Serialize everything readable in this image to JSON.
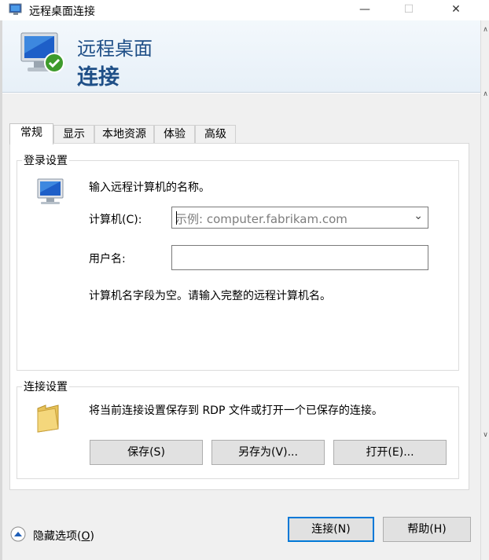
{
  "window": {
    "title": "远程桌面连接",
    "minimize": "—",
    "maximize": "☐",
    "close": "✕"
  },
  "header": {
    "line1": "远程桌面",
    "line2": "连接"
  },
  "tabs": [
    {
      "label": "常规",
      "active": true
    },
    {
      "label": "显示",
      "active": false
    },
    {
      "label": "本地资源",
      "active": false
    },
    {
      "label": "体验",
      "active": false
    },
    {
      "label": "高级",
      "active": false
    }
  ],
  "login_group": {
    "title": "登录设置",
    "instruction": "输入远程计算机的名称。",
    "computer_label": "计算机(C):",
    "computer_placeholder": "示例: computer.fabrikam.com",
    "computer_value": "",
    "username_label": "用户名:",
    "username_value": "",
    "status_message": "计算机名字段为空。请输入完整的远程计算机名。"
  },
  "connection_group": {
    "title": "连接设置",
    "description": "将当前连接设置保存到 RDP 文件或打开一个已保存的连接。",
    "save_label": "保存(S)",
    "save_as_label": "另存为(V)...",
    "open_label": "打开(E)..."
  },
  "footer": {
    "hide_options_label": "隐藏选项(",
    "hide_options_key": "O",
    "hide_options_suffix": ")",
    "connect_label": "连接(N)",
    "help_label": "帮助(H)"
  },
  "colors": {
    "header_text": "#1f4f87",
    "accent": "#0078d7",
    "dialog_bg": "#f0f0f0"
  }
}
